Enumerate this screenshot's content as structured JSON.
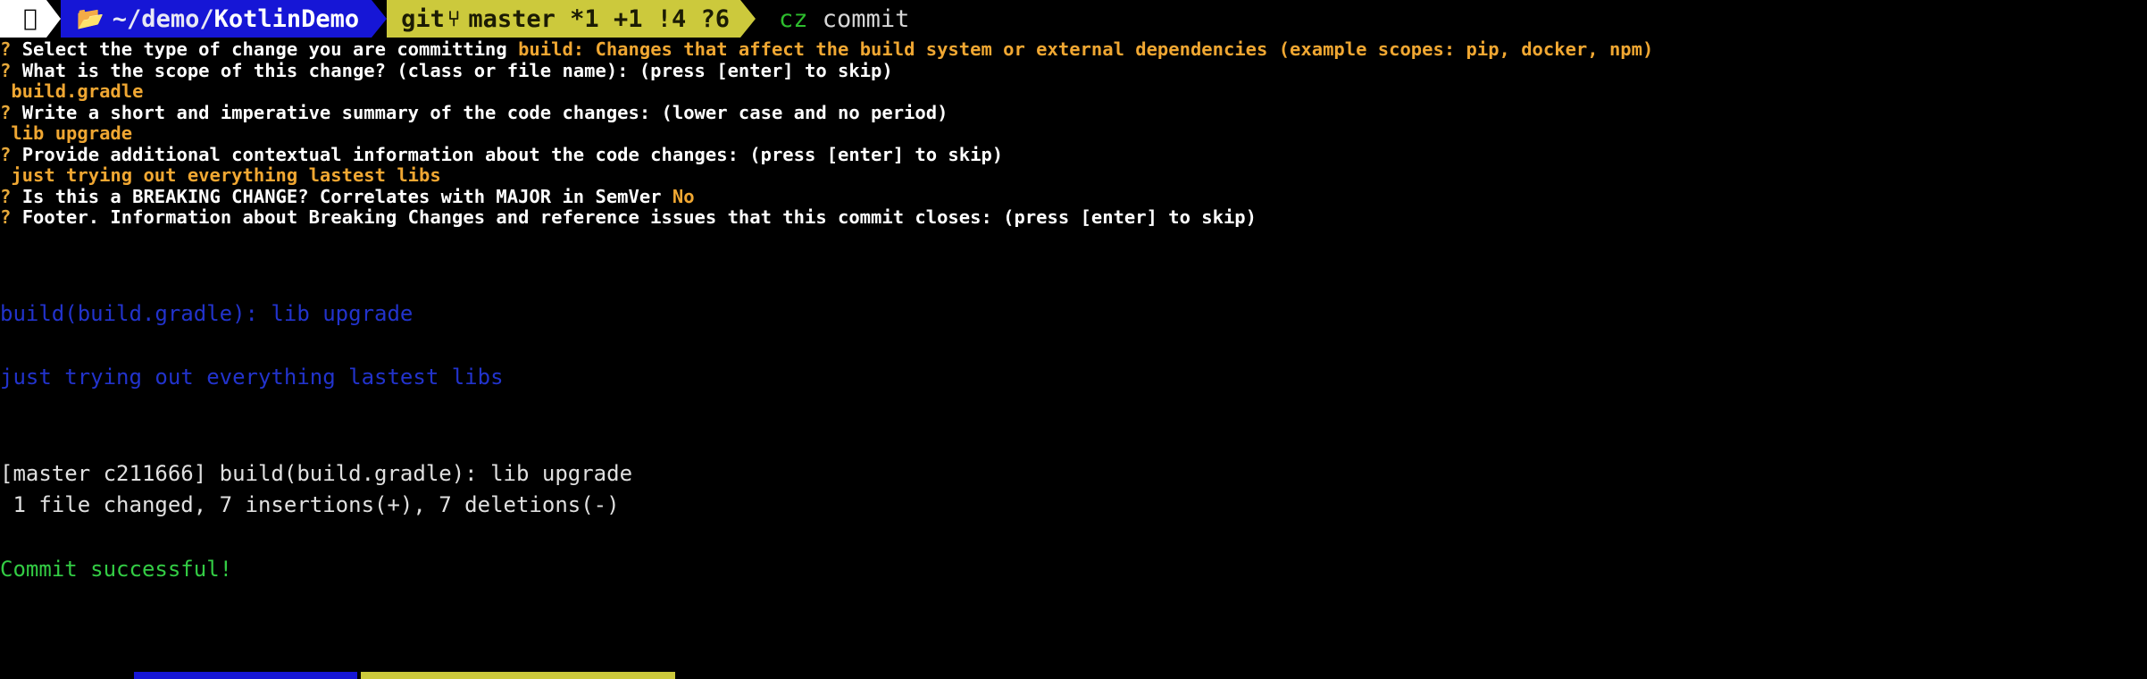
{
  "window": {
    "title": "Terminal — cz commit",
    "background": "#000000"
  },
  "colors": {
    "prompt_path_bg": "#1616d6",
    "prompt_git_bg": "#ccc93c",
    "question_marker": "#e6a83a",
    "answer_text": "#f0a732",
    "command_name": "#2dbd2d",
    "output_blue": "#2233cc",
    "output_green": "#33cc44",
    "output_white": "#d9d9d9"
  },
  "prompt": {
    "apple_icon": "apple-logo-icon",
    "apple_glyph": "",
    "folder_icon": "folder-icon",
    "folder_glyph": "📂",
    "path_prefix": "~/demo/",
    "path_current": "KotlinDemo",
    "git_label": "git",
    "git_branch_icon": "git-branch-icon",
    "git_branch_glyph": "⑂",
    "branch": "master",
    "status_untracked": "*1",
    "status_staged": "+1",
    "status_modified": "!4",
    "status_unknown": "?6",
    "command_name": "cz",
    "command_args": "commit"
  },
  "questions": [
    {
      "marker": "?",
      "text": "Select the type of change you are committing ",
      "answer": "build: Changes that affect the build system or external dependencies (example scopes: pip, docker, npm)",
      "answer_inline": true
    },
    {
      "marker": "?",
      "text": "What is the scope of this change? (class or file name): (press [enter] to skip)",
      "answer": " build.gradle",
      "answer_inline": false
    },
    {
      "marker": "?",
      "text": "Write a short and imperative summary of the code changes: (lower case and no period)",
      "answer": " lib upgrade",
      "answer_inline": false
    },
    {
      "marker": "?",
      "text": "Provide additional contextual information about the code changes: (press [enter] to skip)",
      "answer": " just trying out everything lastest libs",
      "answer_inline": false
    },
    {
      "marker": "?",
      "text": "Is this a BREAKING CHANGE? Correlates with MAJOR in SemVer ",
      "answer": "No",
      "answer_inline": true
    },
    {
      "marker": "?",
      "text": "Footer. Information about Breaking Changes and reference issues that this commit closes: (press [enter] to skip)",
      "answer": "",
      "answer_inline": true
    }
  ],
  "output": [
    {
      "text": "",
      "color": "blank"
    },
    {
      "text": "",
      "color": "blank"
    },
    {
      "text": "build(build.gradle): lib upgrade",
      "color": "blue"
    },
    {
      "text": "",
      "color": "blank"
    },
    {
      "text": "just trying out everything lastest libs",
      "color": "blue"
    },
    {
      "text": "",
      "color": "blank"
    },
    {
      "text": "",
      "color": "blank"
    },
    {
      "text": "[master c211666] build(build.gradle): lib upgrade",
      "color": "white"
    },
    {
      "text": " 1 file changed, 7 insertions(+), 7 deletions(-)",
      "color": "white"
    },
    {
      "text": "",
      "color": "blank"
    },
    {
      "text": "Commit successful!",
      "color": "green"
    }
  ]
}
